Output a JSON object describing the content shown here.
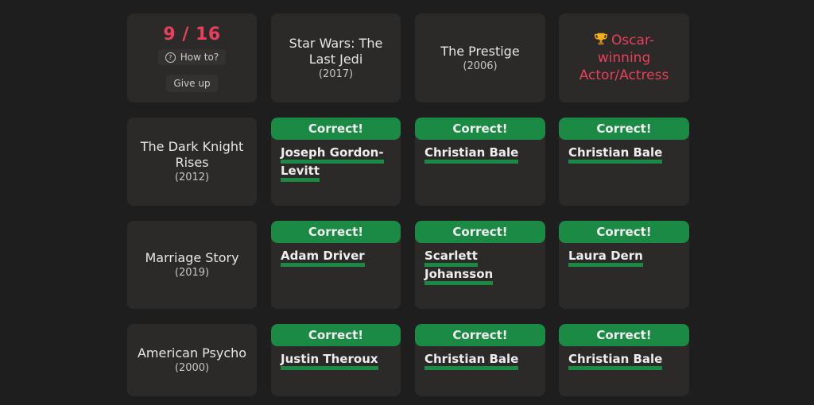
{
  "score": "9 / 16",
  "howto_label": "How to?",
  "giveup_label": "Give up",
  "columns": [
    {
      "title": "Star Wars: The Last Jedi",
      "year": "(2017)"
    },
    {
      "title": "The Prestige",
      "year": "(2006)"
    },
    {
      "criterion": "Oscar-winning Actor/Actress",
      "icon": "trophy-icon"
    }
  ],
  "rows": [
    {
      "title": "The Dark Knight Rises",
      "year": "(2012)",
      "answers": [
        {
          "status": "Correct!",
          "actor": "Joseph Gordon-Levitt"
        },
        {
          "status": "Correct!",
          "actor": "Christian Bale"
        },
        {
          "status": "Correct!",
          "actor": "Christian Bale"
        }
      ]
    },
    {
      "title": "Marriage Story",
      "year": "(2019)",
      "answers": [
        {
          "status": "Correct!",
          "actor": "Adam Driver"
        },
        {
          "status": "Correct!",
          "actor": "Scarlett Johansson"
        },
        {
          "status": "Correct!",
          "actor": "Laura Dern"
        }
      ]
    },
    {
      "title": "American Psycho",
      "year": "(2000)",
      "answers": [
        {
          "status": "Correct!",
          "actor": "Justin Theroux"
        },
        {
          "status": "Correct!",
          "actor": "Christian Bale"
        },
        {
          "status": "Correct!",
          "actor": "Christian Bale"
        }
      ]
    }
  ],
  "colors": {
    "background": "#1f1e1e",
    "cell": "#2b2a29",
    "correct": "#1b8a44",
    "accent": "#e8405c"
  }
}
